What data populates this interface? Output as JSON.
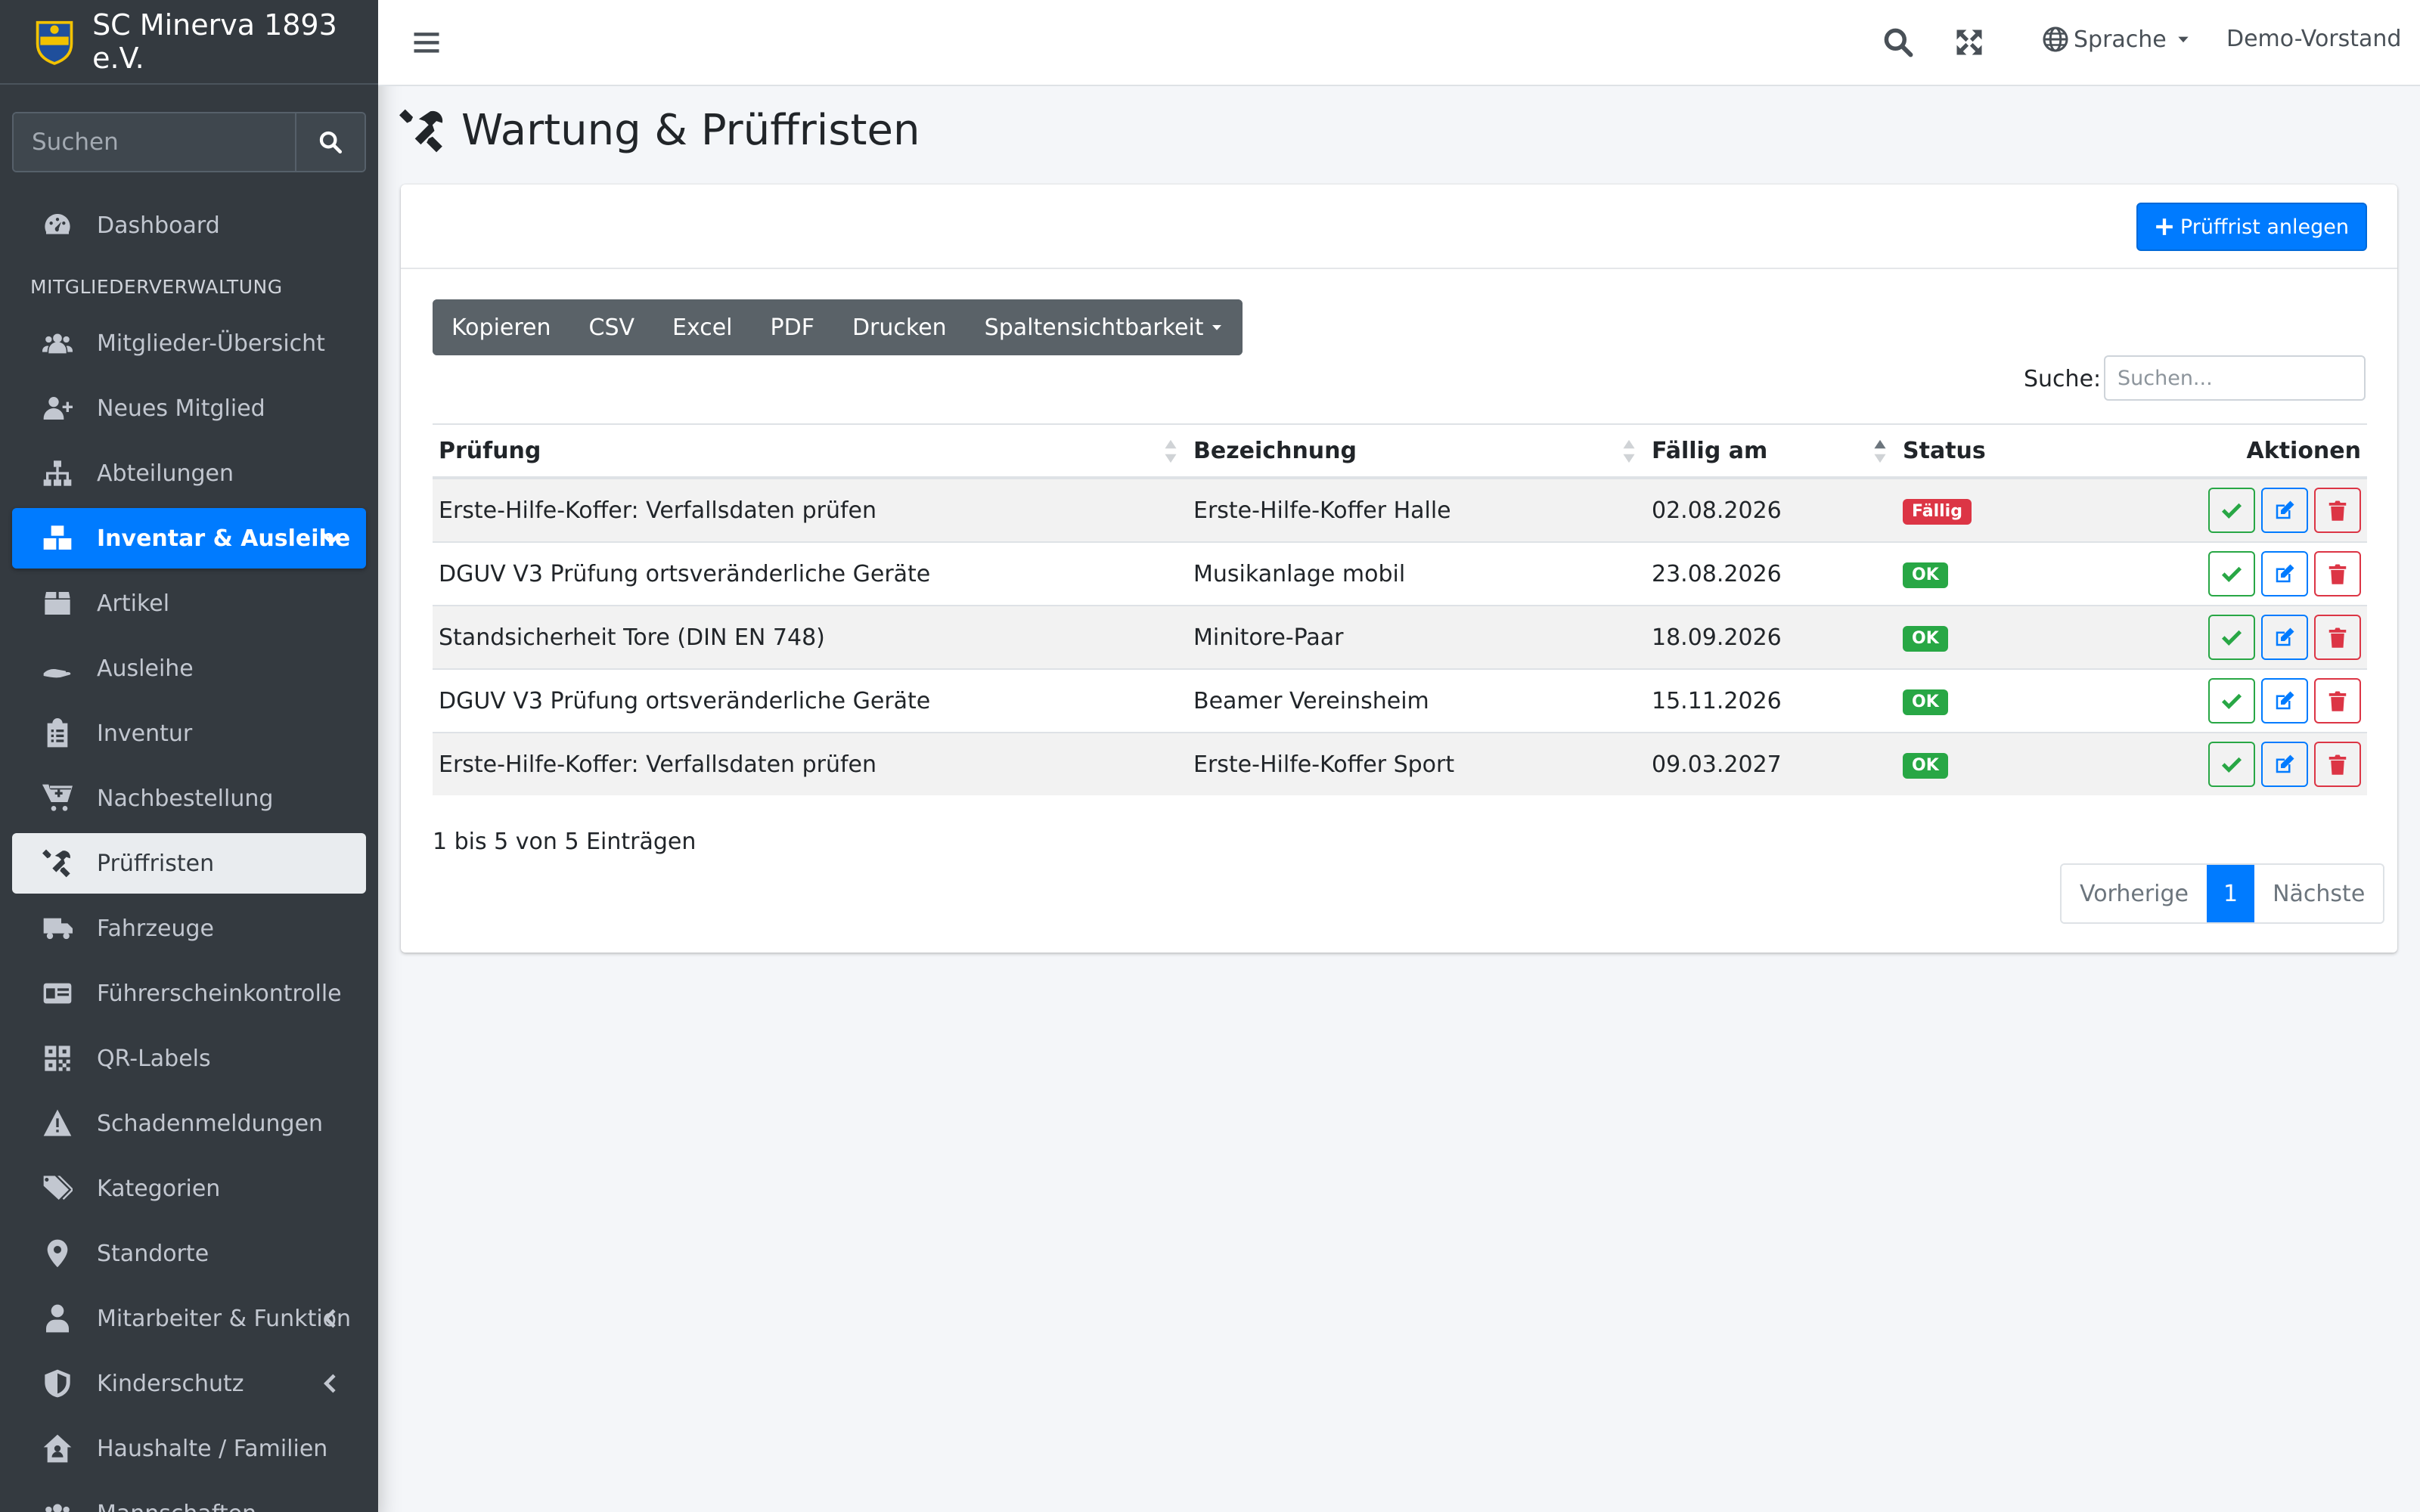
{
  "brand": {
    "name": "SC Minerva 1893 e.V."
  },
  "sidebar": {
    "search_placeholder": "Suchen",
    "items": [
      {
        "label": "Dashboard",
        "icon": "tachometer-icon"
      },
      {
        "header": "MITGLIEDERVERWALTUNG"
      },
      {
        "label": "Mitglieder-Übersicht",
        "icon": "users-icon"
      },
      {
        "label": "Neues Mitglied",
        "icon": "user-plus-icon"
      },
      {
        "label": "Abteilungen",
        "icon": "sitemap-icon"
      },
      {
        "label": "Inventar & Ausleihe",
        "icon": "boxes-icon",
        "state": "open"
      },
      {
        "label": "Artikel",
        "icon": "box-icon"
      },
      {
        "label": "Ausleihe",
        "icon": "hand-holding-icon"
      },
      {
        "label": "Inventur",
        "icon": "clipboard-list-icon"
      },
      {
        "label": "Nachbestellung",
        "icon": "cart-plus-icon"
      },
      {
        "label": "Prüffristen",
        "icon": "tools-icon",
        "state": "active"
      },
      {
        "label": "Fahrzeuge",
        "icon": "truck-icon"
      },
      {
        "label": "Führerscheinkontrolle",
        "icon": "id-card-icon"
      },
      {
        "label": "QR-Labels",
        "icon": "qrcode-icon"
      },
      {
        "label": "Schadenmeldungen",
        "icon": "warning-icon"
      },
      {
        "label": "Kategorien",
        "icon": "tags-icon"
      },
      {
        "label": "Standorte",
        "icon": "map-marker-icon"
      },
      {
        "label": "Mitarbeiter & Funktion",
        "icon": "user-tie-icon"
      },
      {
        "label": "Kinderschutz",
        "icon": "shield-icon"
      },
      {
        "label": "Haushalte / Familien",
        "icon": "house-user-icon"
      },
      {
        "label": "Mannschaften",
        "icon": "users-icon"
      }
    ]
  },
  "topbar": {
    "language_label": "Sprache",
    "user_label": "Demo-Vorstand"
  },
  "page": {
    "title": "Wartung & Prüffristen",
    "create_button": "Prüffrist anlegen"
  },
  "toolbar": {
    "buttons": [
      "Kopieren",
      "CSV",
      "Excel",
      "PDF",
      "Drucken",
      "Spaltensichtbarkeit"
    ]
  },
  "search": {
    "label": "Suche:",
    "placeholder": "Suchen..."
  },
  "table": {
    "columns": [
      "Prüfung",
      "Bezeichnung",
      "Fällig am",
      "Status",
      "Aktionen"
    ],
    "rows": [
      {
        "pruefung": "Erste-Hilfe-Koffer: Verfallsdaten prüfen",
        "bezeichnung": "Erste-Hilfe-Koffer Halle",
        "faellig": "02.08.2026",
        "status": "Fällig"
      },
      {
        "pruefung": "DGUV V3 Prüfung ortsveränderliche Geräte",
        "bezeichnung": "Musikanlage mobil",
        "faellig": "23.08.2026",
        "status": "OK"
      },
      {
        "pruefung": "Standsicherheit Tore (DIN EN 748)",
        "bezeichnung": "Minitore-Paar",
        "faellig": "18.09.2026",
        "status": "OK"
      },
      {
        "pruefung": "DGUV V3 Prüfung ortsveränderliche Geräte",
        "bezeichnung": "Beamer Vereinsheim",
        "faellig": "15.11.2026",
        "status": "OK"
      },
      {
        "pruefung": "Erste-Hilfe-Koffer: Verfallsdaten prüfen",
        "bezeichnung": "Erste-Hilfe-Koffer Sport",
        "faellig": "09.03.2027",
        "status": "OK"
      }
    ]
  },
  "footer": {
    "info": "1 bis 5 von 5 Einträgen",
    "prev": "Vorherige",
    "page": "1",
    "next": "Nächste"
  },
  "colors": {
    "sidebar_bg": "#343a40",
    "primary": "#007bff",
    "danger": "#dc3545",
    "success": "#28a745"
  }
}
